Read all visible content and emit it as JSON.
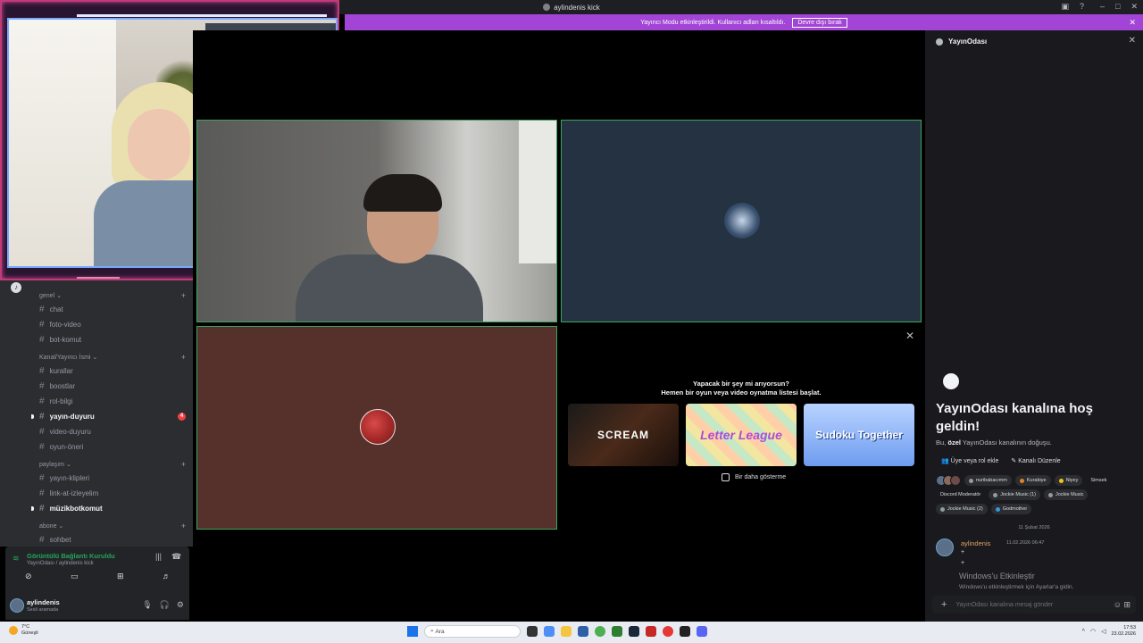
{
  "window": {
    "title": "aylindenis kick"
  },
  "banner": {
    "text": "Yayıncı Modu etkinleştirildi. Kullanıcı adları kısaltıldı.",
    "button": "Devre dışı bırak"
  },
  "sidebar": {
    "categories": [
      {
        "name": "genel ⌄",
        "channels": [
          {
            "name": "chat",
            "bold": false
          },
          {
            "name": "foto-video",
            "bold": false
          },
          {
            "name": "bot-komut",
            "bold": false
          }
        ]
      },
      {
        "name": "Kanal/Yayıncı İsmi ⌄",
        "channels": [
          {
            "name": "kurallar",
            "bold": false
          },
          {
            "name": "boostlar",
            "bold": false
          },
          {
            "name": "rol-bilgi",
            "bold": false
          },
          {
            "name": "yayın-duyuru",
            "bold": true,
            "badge": "4"
          },
          {
            "name": "video-duyuru",
            "bold": false
          },
          {
            "name": "oyun-öneri",
            "bold": false
          }
        ]
      },
      {
        "name": "paylaşım ⌄",
        "channels": [
          {
            "name": "yayın-klipleri",
            "bold": false
          },
          {
            "name": "link-at-izleyelim",
            "bold": false
          },
          {
            "name": "müzikbotkomut",
            "bold": true
          }
        ]
      },
      {
        "name": "abone ⌄",
        "channels": [
          {
            "name": "sohbet",
            "bold": false
          }
        ]
      }
    ]
  },
  "voice": {
    "status": "Görüntülü Bağlantı Kuruldu",
    "location": "YayınOdası / aylindenis kick"
  },
  "user": {
    "name": "aylindenis",
    "status": "Sesli aramada"
  },
  "activity": {
    "title": "Yapacak bir şey mi arıyorsun?",
    "subtitle": "Hemen bir oyun veya video oynatma listesi başlat.",
    "cards": [
      "SCREAM",
      "Letter League",
      "Sudoku Together"
    ],
    "dont_show": "Bir daha gösterme"
  },
  "chat": {
    "header": "YayınOdası",
    "welcome_title": "YayınOdası kanalına hoş geldin!",
    "welcome_sub_prefix": "Bu,",
    "welcome_sub_bold": "özel",
    "welcome_sub_suffix": "YayınOdası kanalının doğuşu.",
    "add_member": "Üye veya rol ekle",
    "edit_channel": "Kanalı Düzenle",
    "roles": [
      {
        "name": "nuribabacımm",
        "color": "#949ba4"
      },
      {
        "name": "Kurabiye",
        "color": "#e67e22"
      },
      {
        "name": "Niyey",
        "color": "#f1c40f"
      },
      {
        "name": "Simsek",
        "color": ""
      },
      {
        "name": "Discord Moderatör",
        "color": ""
      },
      {
        "name": "Jockie Music (1)",
        "color": "#949ba4"
      },
      {
        "name": "Jockie Music",
        "color": "#949ba4"
      },
      {
        "name": "Jockie Music (2)",
        "color": "#949ba4"
      },
      {
        "name": "Godmother",
        "color": "#3498db"
      }
    ],
    "date_divider": "11 Şubat 2026",
    "message": {
      "author": "aylindenis",
      "time": "11.02.2026 06:47",
      "lines": [
        "+",
        "+"
      ]
    },
    "activate_title": "Windows'u Etkinleştir",
    "activate_sub": "Windows'u etkinleştirmek için Ayarlar'a gidin.",
    "input_placeholder": "YayınOdası kanalına mesaj gönder"
  },
  "taskbar": {
    "weather_temp": "7°C",
    "weather_desc": "Güneşli",
    "search_placeholder": "Ara",
    "time": "17:53",
    "date": "23.02.2026"
  }
}
